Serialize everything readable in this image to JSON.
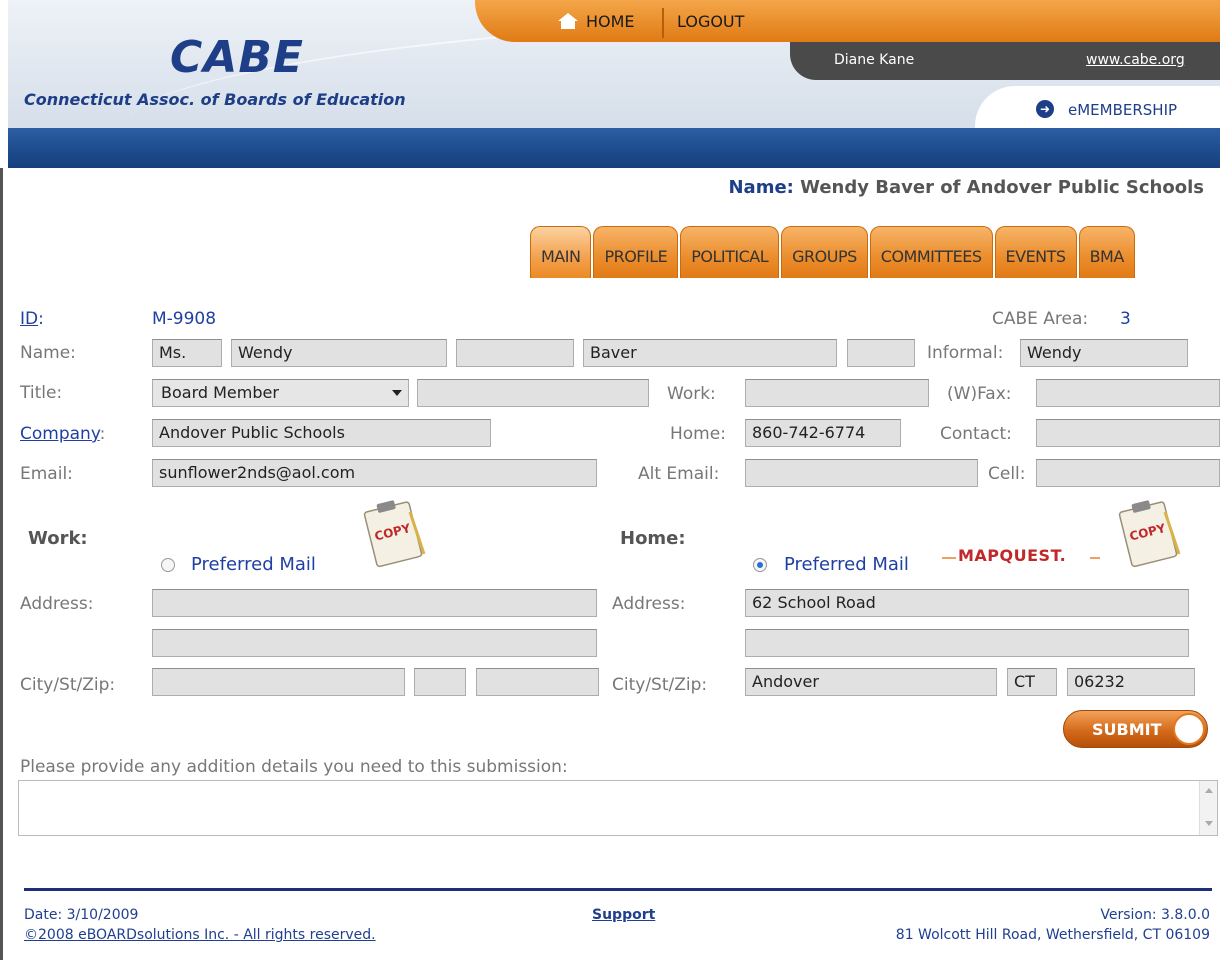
{
  "header": {
    "logo": "CABE",
    "association": "Connecticut Assoc. of Boards of Education",
    "nav": {
      "home": "HOME",
      "logout": "LOGOUT"
    },
    "user_name": "Diane Kane",
    "site_link": "www.cabe.org",
    "emembership": "eMEMBERSHIP"
  },
  "heading": {
    "label": "Name:",
    "value": "Wendy Baver of Andover Public Schools"
  },
  "tabs": [
    {
      "label": "MAIN"
    },
    {
      "label": "PROFILE"
    },
    {
      "label": "POLITICAL"
    },
    {
      "label": "GROUPS"
    },
    {
      "label": "COMMITTEES"
    },
    {
      "label": "EVENTS"
    },
    {
      "label": "BMA"
    }
  ],
  "form": {
    "id_label": "ID",
    "id_value": "M-9908",
    "area_label": "CABE Area:",
    "area_value": "3",
    "name_label": "Name:",
    "salutation": "Ms.",
    "first_name": "Wendy",
    "middle_name": "",
    "last_name": "Baver",
    "suffix": "",
    "informal_label": "Informal:",
    "informal": "Wendy",
    "title_label": "Title:",
    "title_select": "Board Member",
    "title_extra": "",
    "work_label": "Work:",
    "work_phone": "",
    "wfax_label": "(W)Fax:",
    "wfax": "",
    "company_label": "Company",
    "company": "Andover Public Schools",
    "home_label": "Home:",
    "home_phone": "860-742-6774",
    "contact_label": "Contact:",
    "contact": "",
    "email_label": "Email:",
    "email": "sunflower2nds@aol.com",
    "alt_email_label": "Alt Email:",
    "alt_email": "",
    "cell_label": "Cell:",
    "cell": ""
  },
  "work_address": {
    "heading": "Work:",
    "preferred": "Preferred Mail",
    "copy_label": "COPY",
    "address_label": "Address:",
    "address1": "",
    "address2": "",
    "city_label": "City/St/Zip:",
    "city": "",
    "state": "",
    "zip": ""
  },
  "home_address": {
    "heading": "Home:",
    "preferred": "Preferred Mail",
    "mapquest": "MAPQUEST.",
    "copy_label": "COPY",
    "address_label": "Address:",
    "address1": "62 School Road",
    "address2": "",
    "city_label": "City/St/Zip:",
    "city": "Andover",
    "state": "CT",
    "zip": "06232"
  },
  "submit_label": "SUBMIT",
  "details_label": "Please provide any addition details you need to this submission:",
  "details_value": "",
  "footer": {
    "date": "Date: 3/10/2009",
    "copyright": "©2008 eBOARDsolutions Inc. - All rights reserved.",
    "support": "Support",
    "version": "Version: 3.8.0.0",
    "address": "81 Wolcott Hill Road, Wethersfield, CT 06109"
  },
  "colors": {
    "accent_orange": "#e07a14",
    "brand_blue": "#1e3f87"
  }
}
